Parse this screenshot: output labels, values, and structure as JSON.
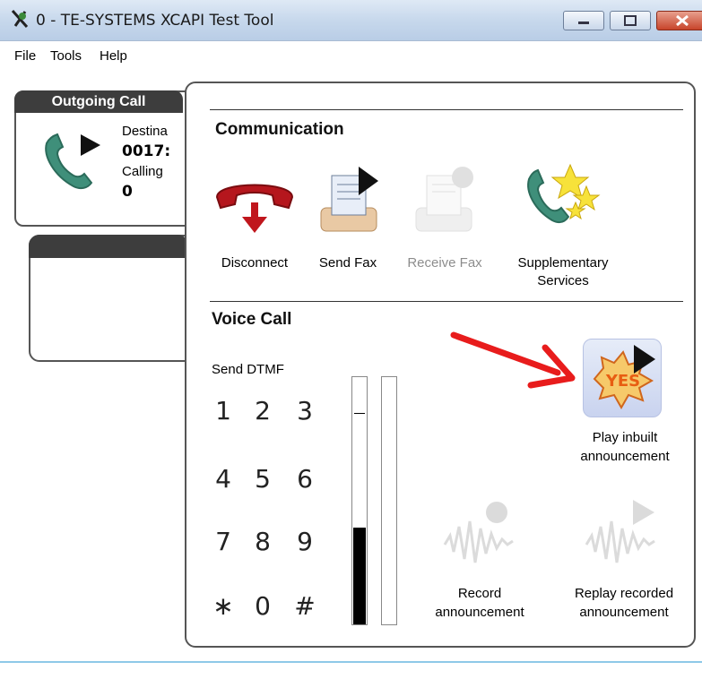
{
  "window": {
    "title": "0 - TE-SYSTEMS XCAPI Test Tool"
  },
  "menu": [
    "File",
    "Tools",
    "Help"
  ],
  "outgoing": {
    "tab_label": "Outgoing Call",
    "dest_label": "Destina",
    "dest_value": "0017:",
    "calling_label": "Calling",
    "calling_value": "0"
  },
  "communication": {
    "title": "Communication",
    "buttons": [
      {
        "label": "Disconnect",
        "icon": "hangup-phone-icon",
        "enabled": true
      },
      {
        "label": "Send Fax",
        "icon": "send-fax-icon",
        "enabled": true
      },
      {
        "label": "Receive Fax",
        "icon": "receive-fax-icon",
        "enabled": false
      },
      {
        "label": "Supplementary Services",
        "label_line1": "Supplementary",
        "label_line2": "Services",
        "icon": "supplementary-services-icon",
        "enabled": true
      }
    ]
  },
  "voice": {
    "title": "Voice Call",
    "dtmf_label": "Send DTMF",
    "keys": [
      "1",
      "2",
      "3",
      "4",
      "5",
      "6",
      "7",
      "8",
      "9",
      "∗",
      "0",
      "#"
    ],
    "meter_level": 0.39,
    "play": {
      "line1": "Play inbuilt",
      "line2": "announcement",
      "icon": "play-announcement-icon"
    },
    "record": {
      "line1": "Record",
      "line2": "announcement",
      "icon": "record-announcement-icon",
      "enabled": false
    },
    "replay": {
      "line1": "Replay recorded",
      "line2": "announcement",
      "icon": "replay-announcement-icon",
      "enabled": false
    }
  },
  "colors": {
    "annotation_arrow": "#e81c1c",
    "accent_title_bar": "#c7d8ec",
    "panel_tab": "#3d3d3d"
  }
}
